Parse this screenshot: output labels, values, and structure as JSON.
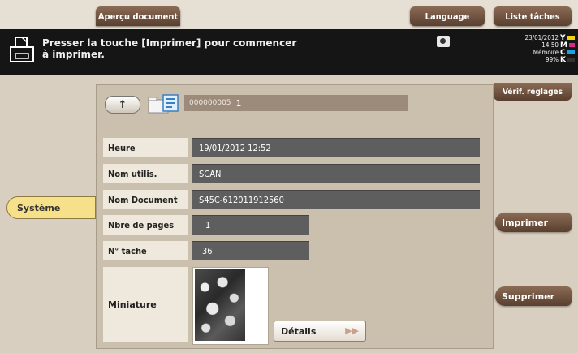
{
  "top_tabs": {
    "apercu": "Aperçu document",
    "language": "Language",
    "liste": "Liste tâches"
  },
  "message": {
    "line1": "Presser la touche [Imprimer] pour commencer",
    "line2": "à imprimer."
  },
  "status": {
    "date": "23/01/2012",
    "time": "14:50",
    "memory_label": "Mémoire",
    "memory_value": "99%",
    "toner": [
      {
        "letter": "Y",
        "color": "#f2d20a"
      },
      {
        "letter": "M",
        "color": "#d8288c"
      },
      {
        "letter": "C",
        "color": "#1aa3e0"
      },
      {
        "letter": "K",
        "color": "#333333"
      }
    ]
  },
  "job": {
    "number_small": "000000005",
    "number": "1"
  },
  "fields": {
    "heure_label": "Heure",
    "heure_value": "19/01/2012  12:52",
    "nom_utilis_label": "Nom utilis.",
    "nom_utilis_value": "SCAN",
    "nom_doc_label": "Nom Document",
    "nom_doc_value": "S45C-612011912560",
    "nbre_pages_label": "Nbre de pages",
    "nbre_pages_value": "1",
    "no_tache_label": "N° tache",
    "no_tache_value": "36",
    "miniature_label": "Miniature"
  },
  "buttons": {
    "details": "Détails",
    "systeme": "Système",
    "verif": "Vérif. réglages",
    "imprimer": "Imprimer",
    "supprimer": "Supprimer"
  },
  "icons": {
    "printer": "printer-icon",
    "up": "up-arrow-icon",
    "folder": "folder-document-icon",
    "camera": "camera-icon"
  }
}
